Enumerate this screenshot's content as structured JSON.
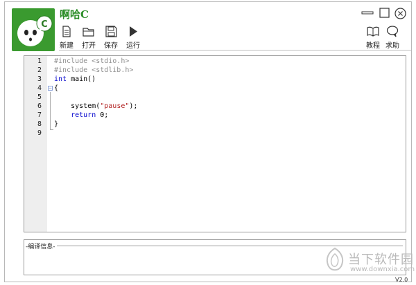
{
  "app": {
    "title": "啊哈C",
    "version": "V2.0"
  },
  "window_controls": [
    {
      "name": "minimize-icon"
    },
    {
      "name": "maximize-icon"
    },
    {
      "name": "close-icon"
    }
  ],
  "toolbar": {
    "items": [
      {
        "label": "新建",
        "icon": "new-file-icon"
      },
      {
        "label": "打开",
        "icon": "open-folder-icon"
      },
      {
        "label": "保存",
        "icon": "save-icon"
      },
      {
        "label": "运行",
        "icon": "run-icon"
      },
      {
        "label": "教程",
        "icon": "book-icon"
      },
      {
        "label": "求助",
        "icon": "help-bubble-icon"
      }
    ]
  },
  "editor": {
    "line_numbers": [
      "1",
      "2",
      "3",
      "4",
      "5",
      "6",
      "7",
      "8",
      "9"
    ],
    "lines": [
      {
        "p1": "#include <stdio.h>"
      },
      {
        "p1": "#include <stdlib.h>"
      },
      {
        "p1": "int",
        "p2": " main()"
      },
      {
        "p1": "{"
      },
      {
        "p1": ""
      },
      {
        "p1": "    system(",
        "p2": "\"pause\"",
        "p3": ");"
      },
      {
        "p1": "    ",
        "p2": "return",
        "p3": " 0;"
      },
      {
        "p1": "}"
      },
      {
        "p1": ""
      }
    ]
  },
  "compile_panel": {
    "header": "-编译信息-"
  },
  "watermark": {
    "brand": "当下软件园",
    "url": "www.downxia.com"
  },
  "colors": {
    "logo_green": "#3a9a2f",
    "title_green": "#2e8f2a",
    "keyword_blue": "#0000cc",
    "string_red": "#b22222",
    "preprocessor_gray": "#8f8f8f"
  }
}
